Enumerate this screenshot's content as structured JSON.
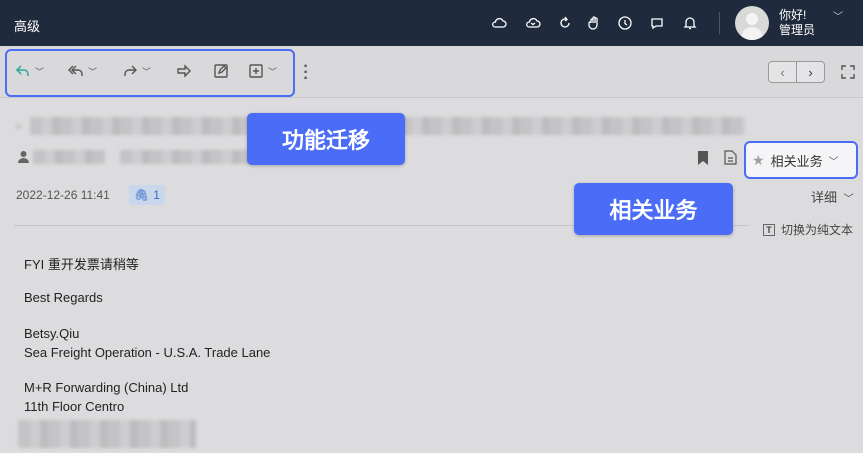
{
  "app": {
    "title": "高级"
  },
  "user": {
    "greeting": "你好!",
    "role": "管理员"
  },
  "topbar_icons": [
    "cloud-icon",
    "cloud-mail-icon",
    "refresh-icon",
    "hand-icon",
    "clock-icon",
    "chat-icon",
    "bell-icon"
  ],
  "pager": {
    "prev": "‹",
    "next": "›"
  },
  "email": {
    "date": "2022-12-26 11:41",
    "attachment_count": "1",
    "detail_label": "详细",
    "plain_text_label": "切换为纯文本",
    "related_label": "相关业务",
    "body": {
      "line1": "FYI 重开发票请稍等",
      "line2": "Best Regards",
      "line3": "Betsy.Qiu",
      "line4": "Sea Freight Operation - U.S.A. Trade Lane",
      "line5": "M+R Forwarding (China) Ltd",
      "line6": "11th Floor Centro"
    }
  },
  "callouts": {
    "feature_migration": "功能迁移",
    "related_business": "相关业务"
  },
  "colors": {
    "topbar": "#1f2a3c",
    "accent": "#4a6cf7",
    "attachment": "#3a6bc8"
  }
}
